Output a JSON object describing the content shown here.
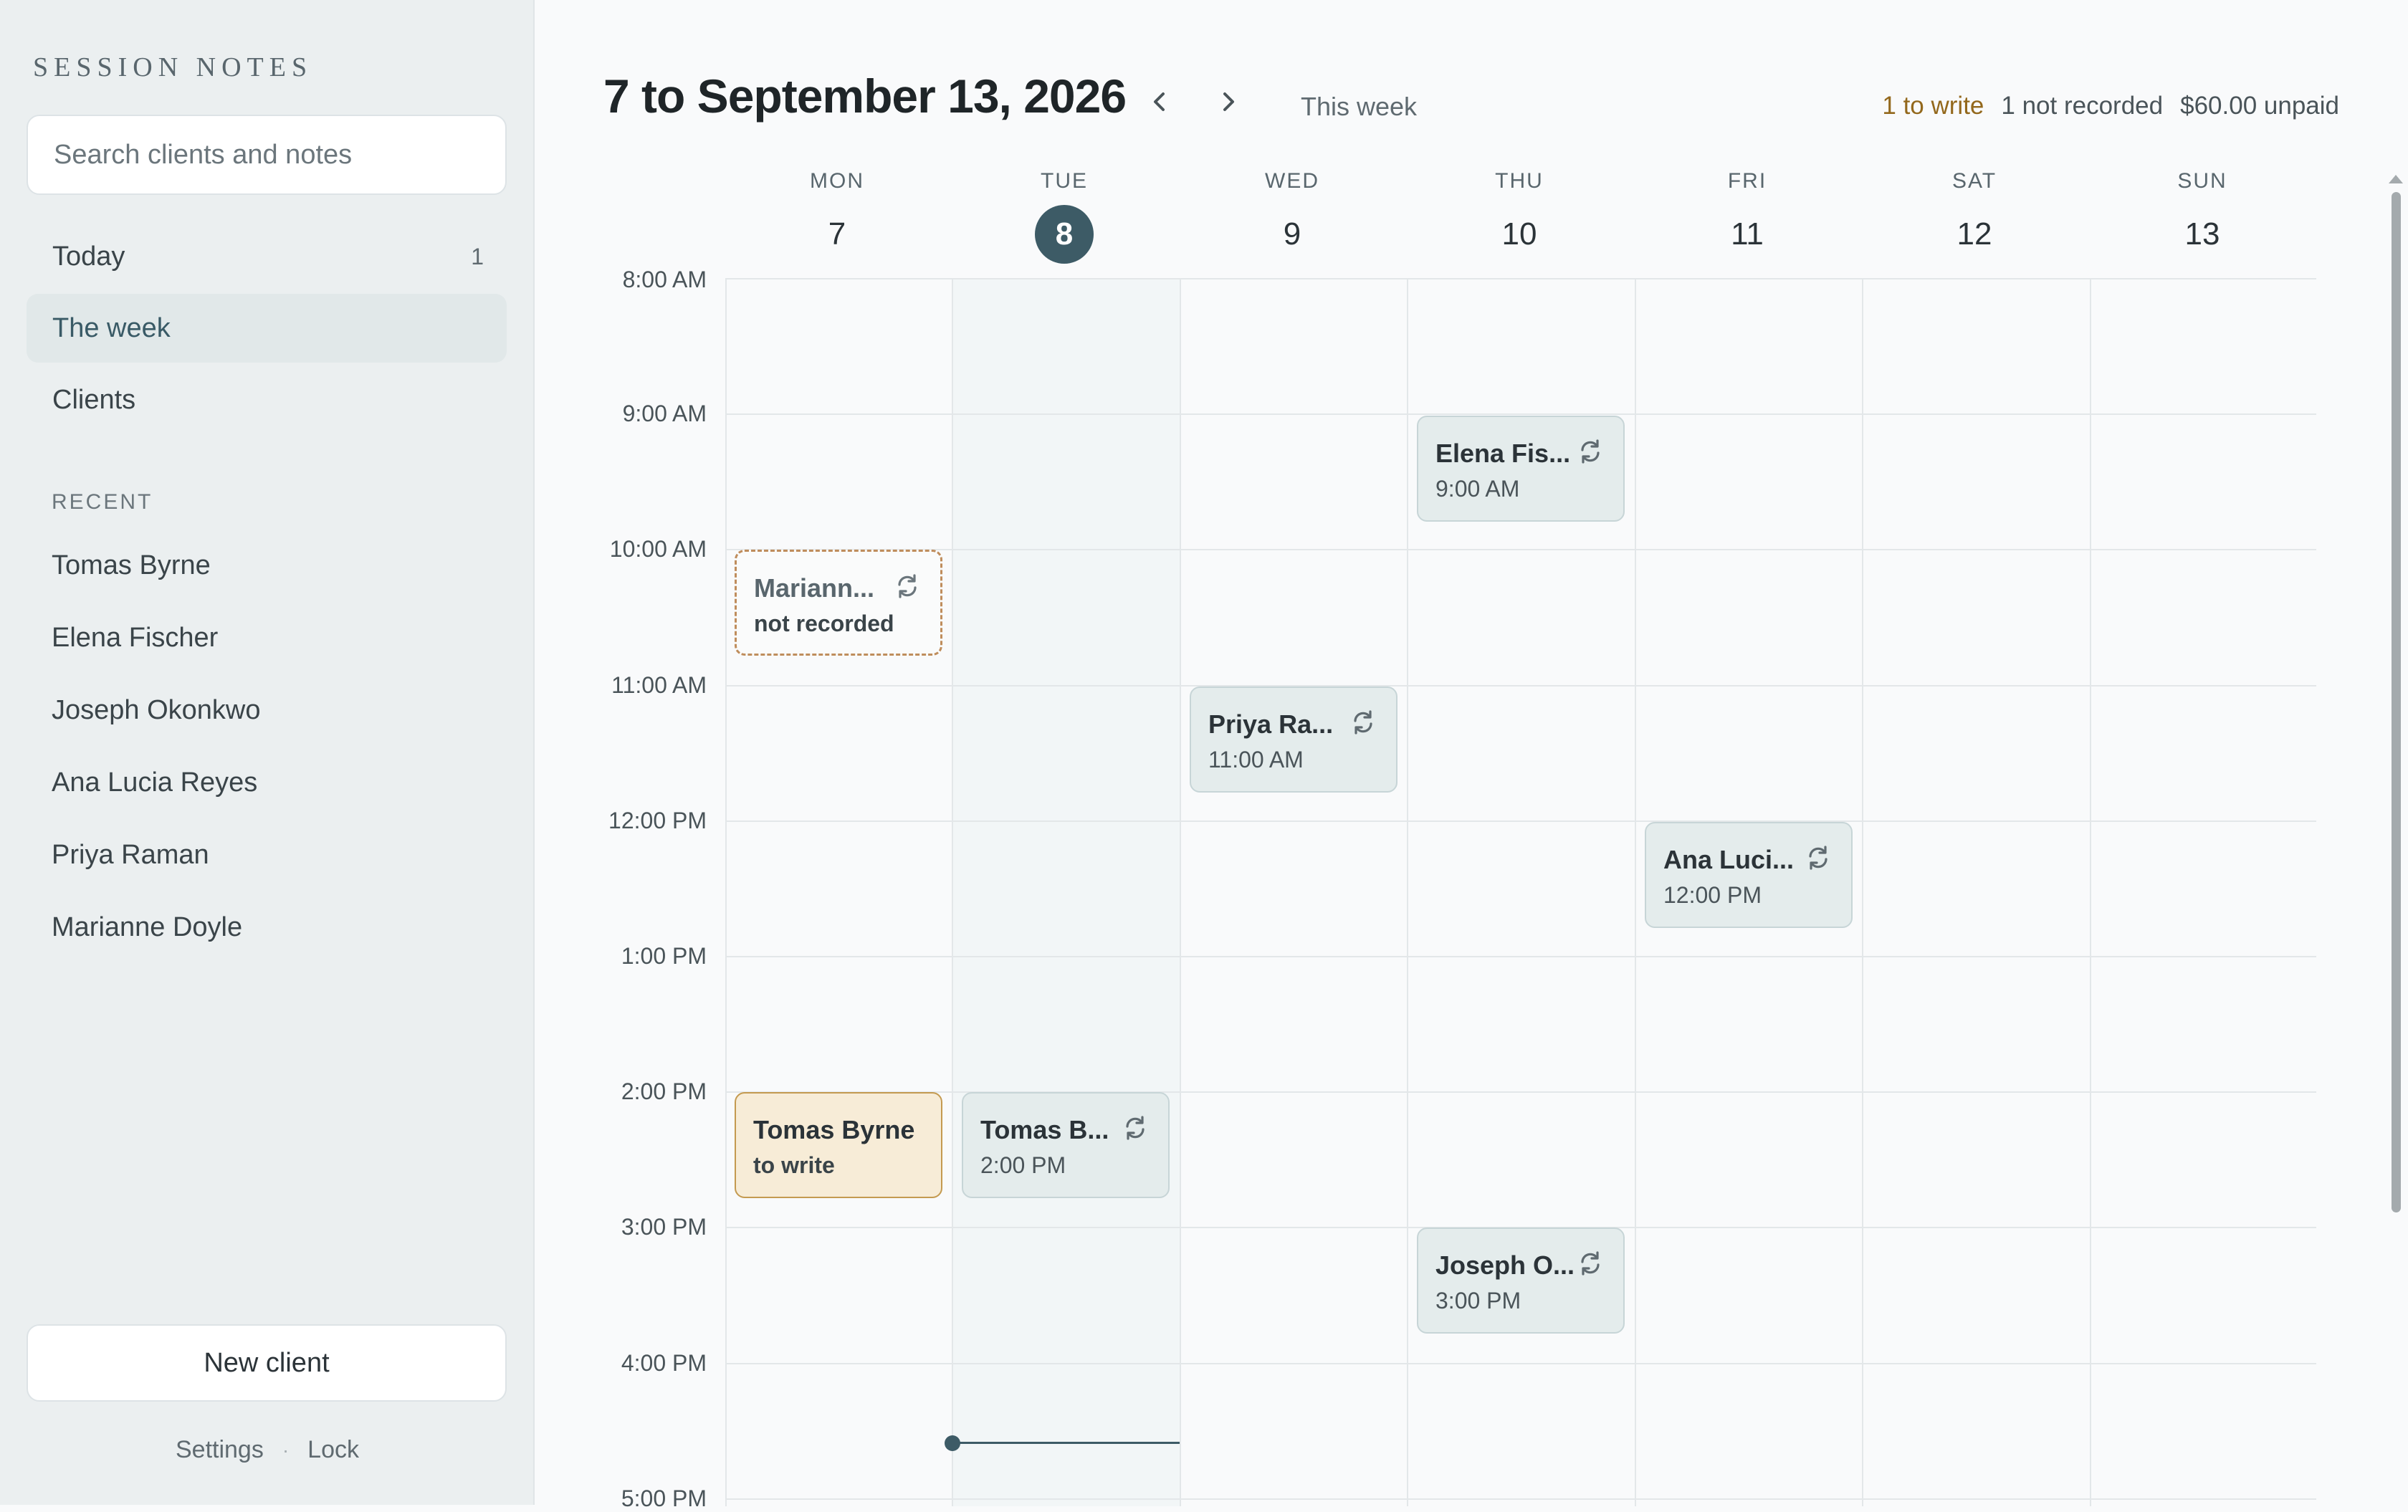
{
  "sidebar": {
    "app_title": "SESSION NOTES",
    "search_placeholder": "Search clients and notes",
    "nav": [
      {
        "label": "Today",
        "count": "1"
      },
      {
        "label": "The week",
        "count": ""
      },
      {
        "label": "Clients",
        "count": ""
      }
    ],
    "active_nav": "The week",
    "recent_label": "RECENT",
    "recent": [
      "Tomas Byrne",
      "Elena Fischer",
      "Joseph Okonkwo",
      "Ana Lucia Reyes",
      "Priya Raman",
      "Marianne Doyle"
    ],
    "new_client_label": "New client",
    "settings_label": "Settings",
    "separator": "·",
    "lock_label": "Lock"
  },
  "header": {
    "range_title": "7 to September 13, 2026",
    "this_week_label": "This week",
    "summary": {
      "to_write": "1 to write",
      "not_recorded": "1 not recorded",
      "unpaid": "$60.00 unpaid"
    }
  },
  "calendar": {
    "days": [
      {
        "name": "MON",
        "num": "7"
      },
      {
        "name": "TUE",
        "num": "8"
      },
      {
        "name": "WED",
        "num": "9"
      },
      {
        "name": "THU",
        "num": "10"
      },
      {
        "name": "FRI",
        "num": "11"
      },
      {
        "name": "SAT",
        "num": "12"
      },
      {
        "name": "SUN",
        "num": "13"
      }
    ],
    "today": "TUE",
    "times": [
      "8:00 AM",
      "9:00 AM",
      "10:00 AM",
      "11:00 AM",
      "12:00 PM",
      "1:00 PM",
      "2:00 PM",
      "3:00 PM",
      "4:00 PM",
      "5:00 PM"
    ],
    "now_time": "4:35 PM",
    "events": [
      {
        "client": "Elena Fischer",
        "display_name": "Elena Fis...",
        "sub": "9:00 AM",
        "day": "THU",
        "start": "9:00 AM",
        "status": "scheduled",
        "recurring": true
      },
      {
        "client": "Marianne Doyle",
        "display_name": "Mariann...",
        "sub": "not recorded",
        "day": "MON",
        "start": "10:00 AM",
        "status": "not recorded",
        "recurring": true
      },
      {
        "client": "Priya Raman",
        "display_name": "Priya Ra...",
        "sub": "11:00 AM",
        "day": "WED",
        "start": "11:00 AM",
        "status": "scheduled",
        "recurring": true
      },
      {
        "client": "Ana Lucia Reyes",
        "display_name": "Ana Luci...",
        "sub": "12:00 PM",
        "day": "FRI",
        "start": "12:00 PM",
        "status": "scheduled",
        "recurring": true
      },
      {
        "client": "Tomas Byrne",
        "display_name": "Tomas Byrne",
        "sub": "to write",
        "day": "MON",
        "start": "2:00 PM",
        "status": "to write",
        "recurring": false
      },
      {
        "client": "Tomas Byrne",
        "display_name": "Tomas B...",
        "sub": "2:00 PM",
        "day": "TUE",
        "start": "2:00 PM",
        "status": "scheduled",
        "recurring": true
      },
      {
        "client": "Joseph Okonkwo",
        "display_name": "Joseph O...",
        "sub": "3:00 PM",
        "day": "THU",
        "start": "3:00 PM",
        "status": "scheduled",
        "recurring": true
      }
    ]
  },
  "icons": {
    "prev": "chevron-left-icon",
    "next": "chevron-right-icon",
    "recurring": "repeat-icon"
  },
  "colors": {
    "accent": "#3d5b66",
    "to_write": "#93681c",
    "pending_bg": "#f7ecd7",
    "missing_border": "#bf8d5c"
  }
}
